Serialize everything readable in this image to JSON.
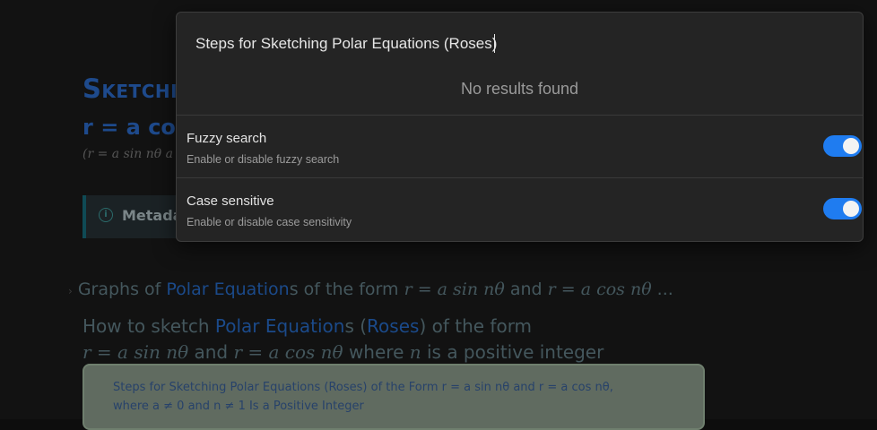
{
  "background": {
    "title": "Sketchi",
    "formula": "r = a co",
    "subtitle": "(r = a sin nθ a",
    "callout_label": "Metada",
    "heading1": {
      "prefix": "Graphs of ",
      "link": "Polar Equation",
      "suffix": "s of the form ",
      "math1": "r = a sin nθ",
      "and": " and ",
      "math2": "r = a cos nθ",
      "ellipsis": " ..."
    },
    "heading2": {
      "prefix": "How to sketch ",
      "link": "Polar Equation",
      "mid": "s (",
      "link2": "Roses",
      "suffix": ") of the form",
      "math1": "r = a sin nθ",
      "and": " and ",
      "math2": "r = a cos nθ",
      "where": " where ",
      "n": "n",
      "tail": " is a positive integer"
    },
    "panel": {
      "line1": "Steps for Sketching Polar Equations (Roses) of the Form r = a sin nθ and r = a cos nθ,",
      "line2": "where a ≠ 0 and n ≠ 1 Is a Positive Integer"
    }
  },
  "search": {
    "query": "Steps for Sketching Polar Equations (Roses)",
    "no_results": "No results found"
  },
  "settings": [
    {
      "name": "Fuzzy search",
      "description": "Enable or disable fuzzy search",
      "enabled": true
    },
    {
      "name": "Case sensitive",
      "description": "Enable or disable case sensitivity",
      "enabled": true
    }
  ],
  "colors": {
    "toggle_on": "#1f7cf0",
    "link": "#1b4a8a"
  }
}
